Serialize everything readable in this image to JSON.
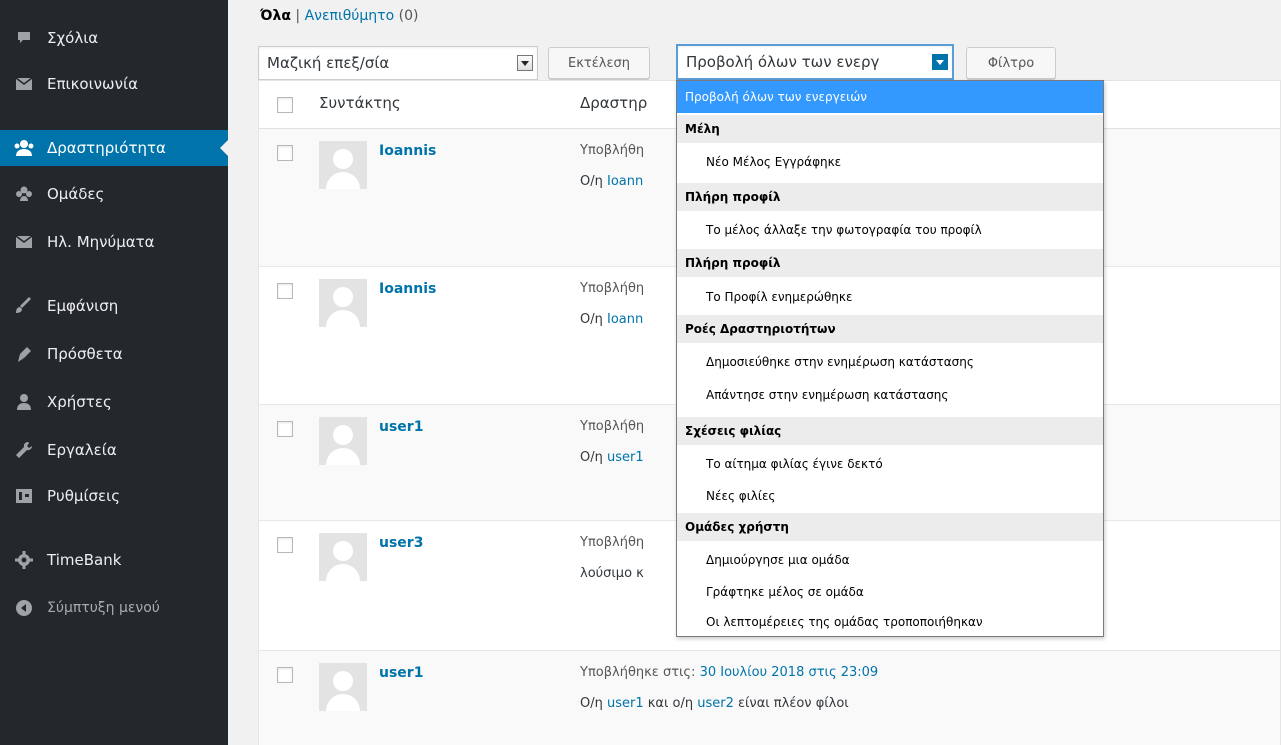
{
  "sidebar": {
    "items": [
      {
        "label": "Σχόλια",
        "icon": "comment-icon"
      },
      {
        "label": "Επικοινωνία",
        "icon": "envelope-icon"
      },
      {
        "label": "Δραστηριότητα",
        "icon": "activity-icon",
        "active": true
      },
      {
        "label": "Ομάδες",
        "icon": "groups-icon"
      },
      {
        "label": "Ηλ. Μηνύματα",
        "icon": "mail-icon"
      },
      {
        "label": "Εμφάνιση",
        "icon": "paintbrush-icon"
      },
      {
        "label": "Πρόσθετα",
        "icon": "plugin-icon"
      },
      {
        "label": "Χρήστες",
        "icon": "users-icon"
      },
      {
        "label": "Εργαλεία",
        "icon": "wrench-icon"
      },
      {
        "label": "Ρυθμίσεις",
        "icon": "settings-icon"
      },
      {
        "label": "TimeBank",
        "icon": "gear-icon"
      },
      {
        "label": "Σύμπτυξη μενού",
        "icon": "collapse-icon"
      }
    ]
  },
  "views": {
    "all_label": "Όλα",
    "separator": "|",
    "spam_label": "Ανεπιθύμητο",
    "spam_count": "(0)"
  },
  "toolbar": {
    "bulk_action_value": "Μαζική επεξ/σία",
    "apply_label": "Εκτέλεση",
    "filter_value": "Προβολή όλων των ενεργ",
    "filter_label": "Φίλτρο"
  },
  "table": {
    "col_author": "Συντάκτης",
    "col_activity": "Δραστηρ",
    "rows": [
      {
        "author": "Ioannis",
        "submitted": "Υποβλήθη",
        "action_prefix": "Ο/η ",
        "action_link": "Ioann",
        "action_suffix": ""
      },
      {
        "author": "Ioannis",
        "submitted": "Υποβλήθη",
        "action_prefix": "Ο/η ",
        "action_link": "Ioann",
        "action_suffix": ""
      },
      {
        "author": "user1",
        "submitted": "Υποβλήθη",
        "action_prefix": "Ο/η ",
        "action_link": "user1",
        "action_suffix": ""
      },
      {
        "author": "user3",
        "submitted": "Υποβλήθη",
        "action_prefix": "λούσιμο κ",
        "action_link": "",
        "action_suffix": ""
      },
      {
        "author": "user1",
        "submitted_prefix": "Υποβλήθηκε στις: ",
        "submitted_link": "30 Ιουλίου 2018 στις 23:09",
        "action_prefix": "Ο/η ",
        "action_link": "user1",
        "action_middle": " και ο/η ",
        "action_link2": "user2",
        "action_suffix": " είναι πλέον φίλοι"
      }
    ]
  },
  "dropdown": {
    "selected": "Προβολή όλων των ενεργειών",
    "groups": [
      {
        "label": "Μέλη",
        "options": [
          "Νέο Μέλος Εγγράφηκε"
        ]
      },
      {
        "label": "Πλήρη προφίλ",
        "options": [
          "Το μέλος άλλαξε την φωτογραφία του προφίλ"
        ]
      },
      {
        "label": "Πλήρη προφίλ",
        "options": [
          "Το Προφίλ ενημερώθηκε"
        ]
      },
      {
        "label": "Ροές Δραστηριοτήτων",
        "options": [
          "Δημοσιεύθηκε στην ενημέρωση κατάστασης",
          "Απάντησε στην ενημέρωση κατάστασης"
        ]
      },
      {
        "label": "Σχέσεις φιλίας",
        "options": [
          "Το αίτημα φιλίας έγινε δεκτό",
          "Νέες φιλίες"
        ]
      },
      {
        "label": "Ομάδες χρήστη",
        "options": [
          "Δημιούργησε μια ομάδα",
          "Γράφτηκε μέλος σε ομάδα",
          "Οι λεπτομέρειες της ομάδας τροποποιήθηκαν"
        ]
      }
    ]
  },
  "colors": {
    "sidebar_bg": "#23282d",
    "accent": "#0073aa",
    "dropdown_highlight": "#3399ff"
  }
}
